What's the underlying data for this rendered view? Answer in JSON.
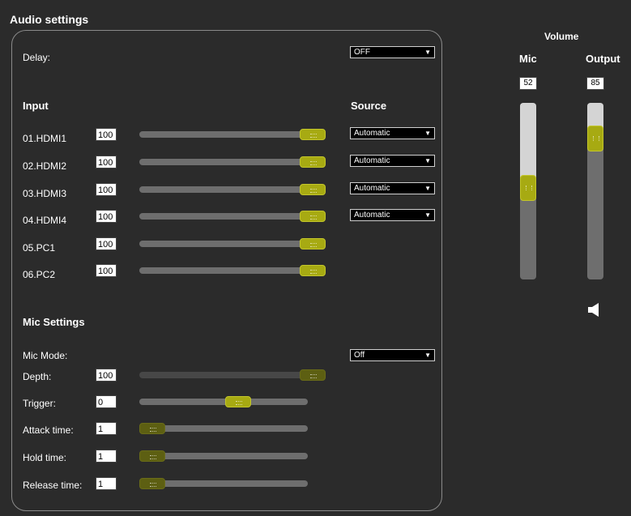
{
  "title": "Audio settings",
  "delay": {
    "label": "Delay:",
    "value": "OFF"
  },
  "input_header": "Input",
  "source_header": "Source",
  "inputs": [
    {
      "name": "01.HDMI1",
      "value": "100",
      "level": 1.0,
      "source": "Automatic"
    },
    {
      "name": "02.HDMI2",
      "value": "100",
      "level": 1.0,
      "source": "Automatic"
    },
    {
      "name": "03.HDMI3",
      "value": "100",
      "level": 1.0,
      "source": "Automatic"
    },
    {
      "name": "04.HDMI4",
      "value": "100",
      "level": 1.0,
      "source": "Automatic"
    },
    {
      "name": "05.PC1",
      "value": "100",
      "level": 1.0
    },
    {
      "name": "06.PC2",
      "value": "100",
      "level": 1.0
    }
  ],
  "mic_settings": {
    "header": "Mic Settings",
    "mode_label": "Mic Mode:",
    "mode_value": "Off",
    "rows": [
      {
        "label": "Depth:",
        "value": "100",
        "level": 1.0
      },
      {
        "label": "Trigger:",
        "value": "0",
        "level": 0.6
      },
      {
        "label": "Attack time:",
        "value": "1",
        "level": 0.0
      },
      {
        "label": "Hold time:",
        "value": "1",
        "level": 0.0
      },
      {
        "label": "Release time:",
        "value": "1",
        "level": 0.0
      }
    ]
  },
  "volume": {
    "header": "Volume",
    "mic": {
      "label": "Mic",
      "value": "52",
      "level": 0.52
    },
    "output": {
      "label": "Output",
      "value": "85",
      "level": 0.85
    },
    "speaker_icon": "speaker-icon"
  },
  "colors": {
    "accent": "#a7aa12",
    "background": "#2b2b2b",
    "track": "#6e6e6e"
  }
}
